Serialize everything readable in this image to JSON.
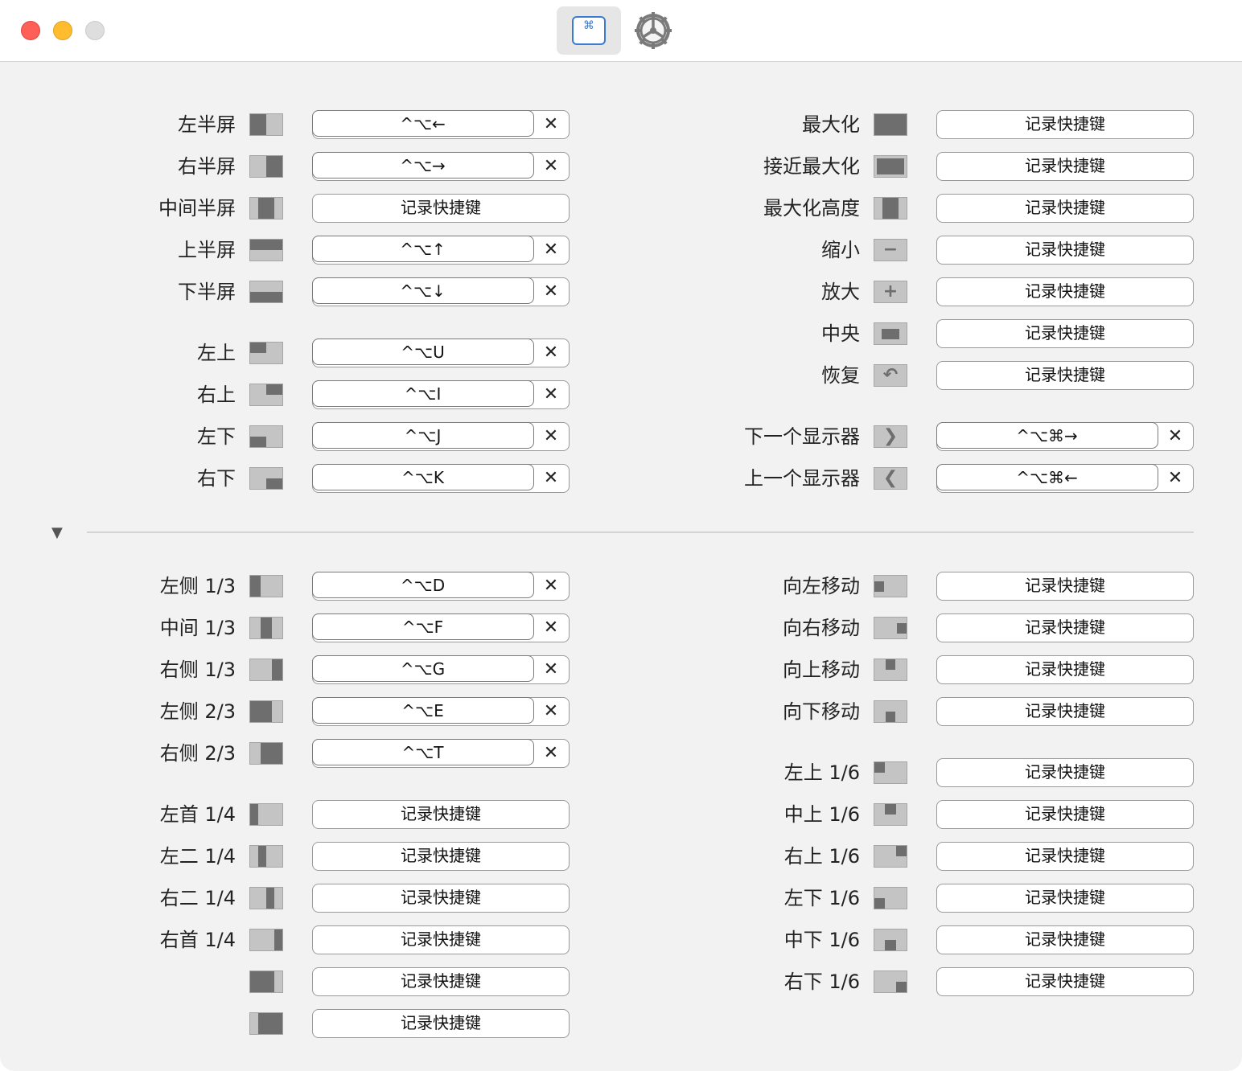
{
  "toolbar": {
    "shortcuts_tab_icon": "keyboard-command-icon",
    "shortcuts_tab_glyph": "⌘",
    "settings_tab_icon": "gear-icon"
  },
  "shortcuts": {
    "record_label": "记录快捷键",
    "clear_glyph": "✕",
    "left_top": [
      {
        "label": "左半屏",
        "shortcut": "^⌥←",
        "icon": "left-half"
      },
      {
        "label": "右半屏",
        "shortcut": "^⌥→",
        "icon": "right-half"
      },
      {
        "label": "中间半屏",
        "shortcut": "",
        "icon": "center-half"
      },
      {
        "label": "上半屏",
        "shortcut": "^⌥↑",
        "icon": "top-half"
      },
      {
        "label": "下半屏",
        "shortcut": "^⌥↓",
        "icon": "bottom-half"
      },
      {
        "label": "左上",
        "shortcut": "^⌥U",
        "icon": "top-left"
      },
      {
        "label": "右上",
        "shortcut": "^⌥I",
        "icon": "top-right"
      },
      {
        "label": "左下",
        "shortcut": "^⌥J",
        "icon": "bottom-left"
      },
      {
        "label": "右下",
        "shortcut": "^⌥K",
        "icon": "bottom-right"
      }
    ],
    "right_top": [
      {
        "label": "最大化",
        "shortcut": "",
        "icon": "maximize"
      },
      {
        "label": "接近最大化",
        "shortcut": "",
        "icon": "almost-maximize"
      },
      {
        "label": "最大化高度",
        "shortcut": "",
        "icon": "maximize-height"
      },
      {
        "label": "缩小",
        "shortcut": "",
        "icon": "smaller"
      },
      {
        "label": "放大",
        "shortcut": "",
        "icon": "larger"
      },
      {
        "label": "中央",
        "shortcut": "",
        "icon": "center"
      },
      {
        "label": "恢复",
        "shortcut": "",
        "icon": "restore"
      },
      {
        "label": "下一个显示器",
        "shortcut": "^⌥⌘→",
        "icon": "next-display"
      },
      {
        "label": "上一个显示器",
        "shortcut": "^⌥⌘←",
        "icon": "prev-display"
      }
    ],
    "left_bottom": [
      {
        "label": "左侧 1/3",
        "shortcut": "^⌥D",
        "icon": "first-third"
      },
      {
        "label": "中间 1/3",
        "shortcut": "^⌥F",
        "icon": "center-third"
      },
      {
        "label": "右侧 1/3",
        "shortcut": "^⌥G",
        "icon": "last-third"
      },
      {
        "label": "左侧 2/3",
        "shortcut": "^⌥E",
        "icon": "first-two-thirds"
      },
      {
        "label": "右侧 2/3",
        "shortcut": "^⌥T",
        "icon": "last-two-thirds"
      },
      {
        "label": "左首 1/4",
        "shortcut": "",
        "icon": "first-fourth"
      },
      {
        "label": "左二 1/4",
        "shortcut": "",
        "icon": "second-fourth"
      },
      {
        "label": "右二 1/4",
        "shortcut": "",
        "icon": "third-fourth"
      },
      {
        "label": "右首 1/4",
        "shortcut": "",
        "icon": "last-fourth"
      },
      {
        "label": "",
        "shortcut": "",
        "icon": "first-three-fourths"
      },
      {
        "label": "",
        "shortcut": "",
        "icon": "last-three-fourths"
      }
    ],
    "right_bottom": [
      {
        "label": "向左移动",
        "shortcut": "",
        "icon": "move-left"
      },
      {
        "label": "向右移动",
        "shortcut": "",
        "icon": "move-right"
      },
      {
        "label": "向上移动",
        "shortcut": "",
        "icon": "move-up"
      },
      {
        "label": "向下移动",
        "shortcut": "",
        "icon": "move-down"
      },
      {
        "label": "左上 1/6",
        "shortcut": "",
        "icon": "top-left-sixth"
      },
      {
        "label": "中上 1/6",
        "shortcut": "",
        "icon": "top-center-sixth"
      },
      {
        "label": "右上 1/6",
        "shortcut": "",
        "icon": "top-right-sixth"
      },
      {
        "label": "左下 1/6",
        "shortcut": "",
        "icon": "bottom-left-sixth"
      },
      {
        "label": "中下 1/6",
        "shortcut": "",
        "icon": "bottom-center-sixth"
      },
      {
        "label": "右下 1/6",
        "shortcut": "",
        "icon": "bottom-right-sixth"
      }
    ]
  },
  "section_toggle": {
    "glyph": "▼",
    "icon": "disclosure-triangle-icon"
  }
}
